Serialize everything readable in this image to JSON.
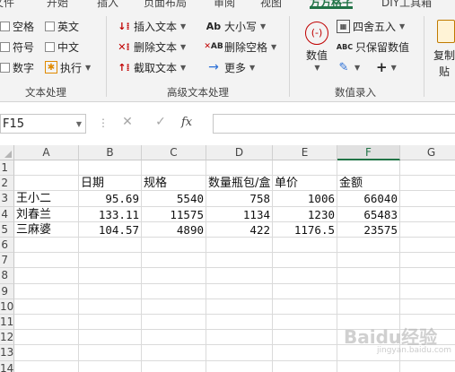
{
  "ribbon_tabs": [
    {
      "label": "文件",
      "active": false
    },
    {
      "label": "开始",
      "active": false
    },
    {
      "label": "插入",
      "active": false
    },
    {
      "label": "页面布局",
      "active": false
    },
    {
      "label": "审阅",
      "active": false
    },
    {
      "label": "视图",
      "active": false
    },
    {
      "label": "方方格子",
      "active": true
    },
    {
      "label": "DIY工具箱",
      "active": false
    }
  ],
  "ribbon": {
    "text_group": {
      "label": "文本处理",
      "checks": [
        {
          "label": "空格"
        },
        {
          "label": "英文"
        },
        {
          "label": "符号"
        },
        {
          "label": "中文"
        },
        {
          "label": "数字"
        }
      ],
      "execute_label": "执行"
    },
    "advanced_group": {
      "label": "高级文本处理",
      "insert_text": "插入文本",
      "delete_text": "删除文本",
      "extract_text": "截取文本",
      "case_label": "大小写",
      "delete_spaces": "删除空格",
      "more": "更多"
    },
    "number_group": {
      "label": "数值录入",
      "value_label": "数值",
      "round_label": "四舍五入",
      "keep_value": "只保留数值"
    },
    "copy_paste_label": "复制粘贴",
    "copy_label": "复制",
    "paste_label": "贴"
  },
  "formula_bar": {
    "name_box": "F15",
    "cancel_symbol": "✕",
    "enter_symbol": "✓",
    "fx_label": "fx",
    "formula": ""
  },
  "columns": [
    "A",
    "B",
    "C",
    "D",
    "E",
    "F",
    "G"
  ],
  "selected_column": "F",
  "rows": [
    {
      "num": "1",
      "cells": [
        "",
        "",
        "",
        "",
        "",
        ""
      ]
    },
    {
      "num": "2",
      "cells": [
        "",
        "日期",
        "规格",
        "数量瓶包/盒",
        "单价",
        "金额"
      ]
    },
    {
      "num": "3",
      "cells": [
        "王小二",
        "95.69",
        "5540",
        "758",
        "1006",
        "66040"
      ]
    },
    {
      "num": "4",
      "cells": [
        "刘春兰",
        "133.11",
        "11575",
        "1134",
        "1230",
        "65483"
      ]
    },
    {
      "num": "5",
      "cells": [
        "三麻婆",
        "104.57",
        "4890",
        "422",
        "1176.5",
        "23575"
      ]
    },
    {
      "num": "6",
      "cells": [
        "",
        "",
        "",
        "",
        "",
        ""
      ]
    },
    {
      "num": "7",
      "cells": [
        "",
        "",
        "",
        "",
        "",
        ""
      ]
    },
    {
      "num": "8",
      "cells": [
        "",
        "",
        "",
        "",
        "",
        ""
      ]
    },
    {
      "num": "9",
      "cells": [
        "",
        "",
        "",
        "",
        "",
        ""
      ]
    },
    {
      "num": "10",
      "cells": [
        "",
        "",
        "",
        "",
        "",
        ""
      ]
    },
    {
      "num": "11",
      "cells": [
        "",
        "",
        "",
        "",
        "",
        ""
      ]
    },
    {
      "num": "12",
      "cells": [
        "",
        "",
        "",
        "",
        "",
        ""
      ]
    },
    {
      "num": "13",
      "cells": [
        "",
        "",
        "",
        "",
        "",
        ""
      ]
    },
    {
      "num": "14",
      "cells": [
        "",
        "",
        "",
        "",
        "",
        ""
      ]
    }
  ],
  "watermark": {
    "text": "Baidu经验",
    "sub": "jingyan.baidu.com"
  },
  "colors": {
    "accent": "#217346",
    "ribbon_bg": "#f3f3f3",
    "red_icon": "#c00000",
    "blue_icon": "#2b6fd6"
  }
}
